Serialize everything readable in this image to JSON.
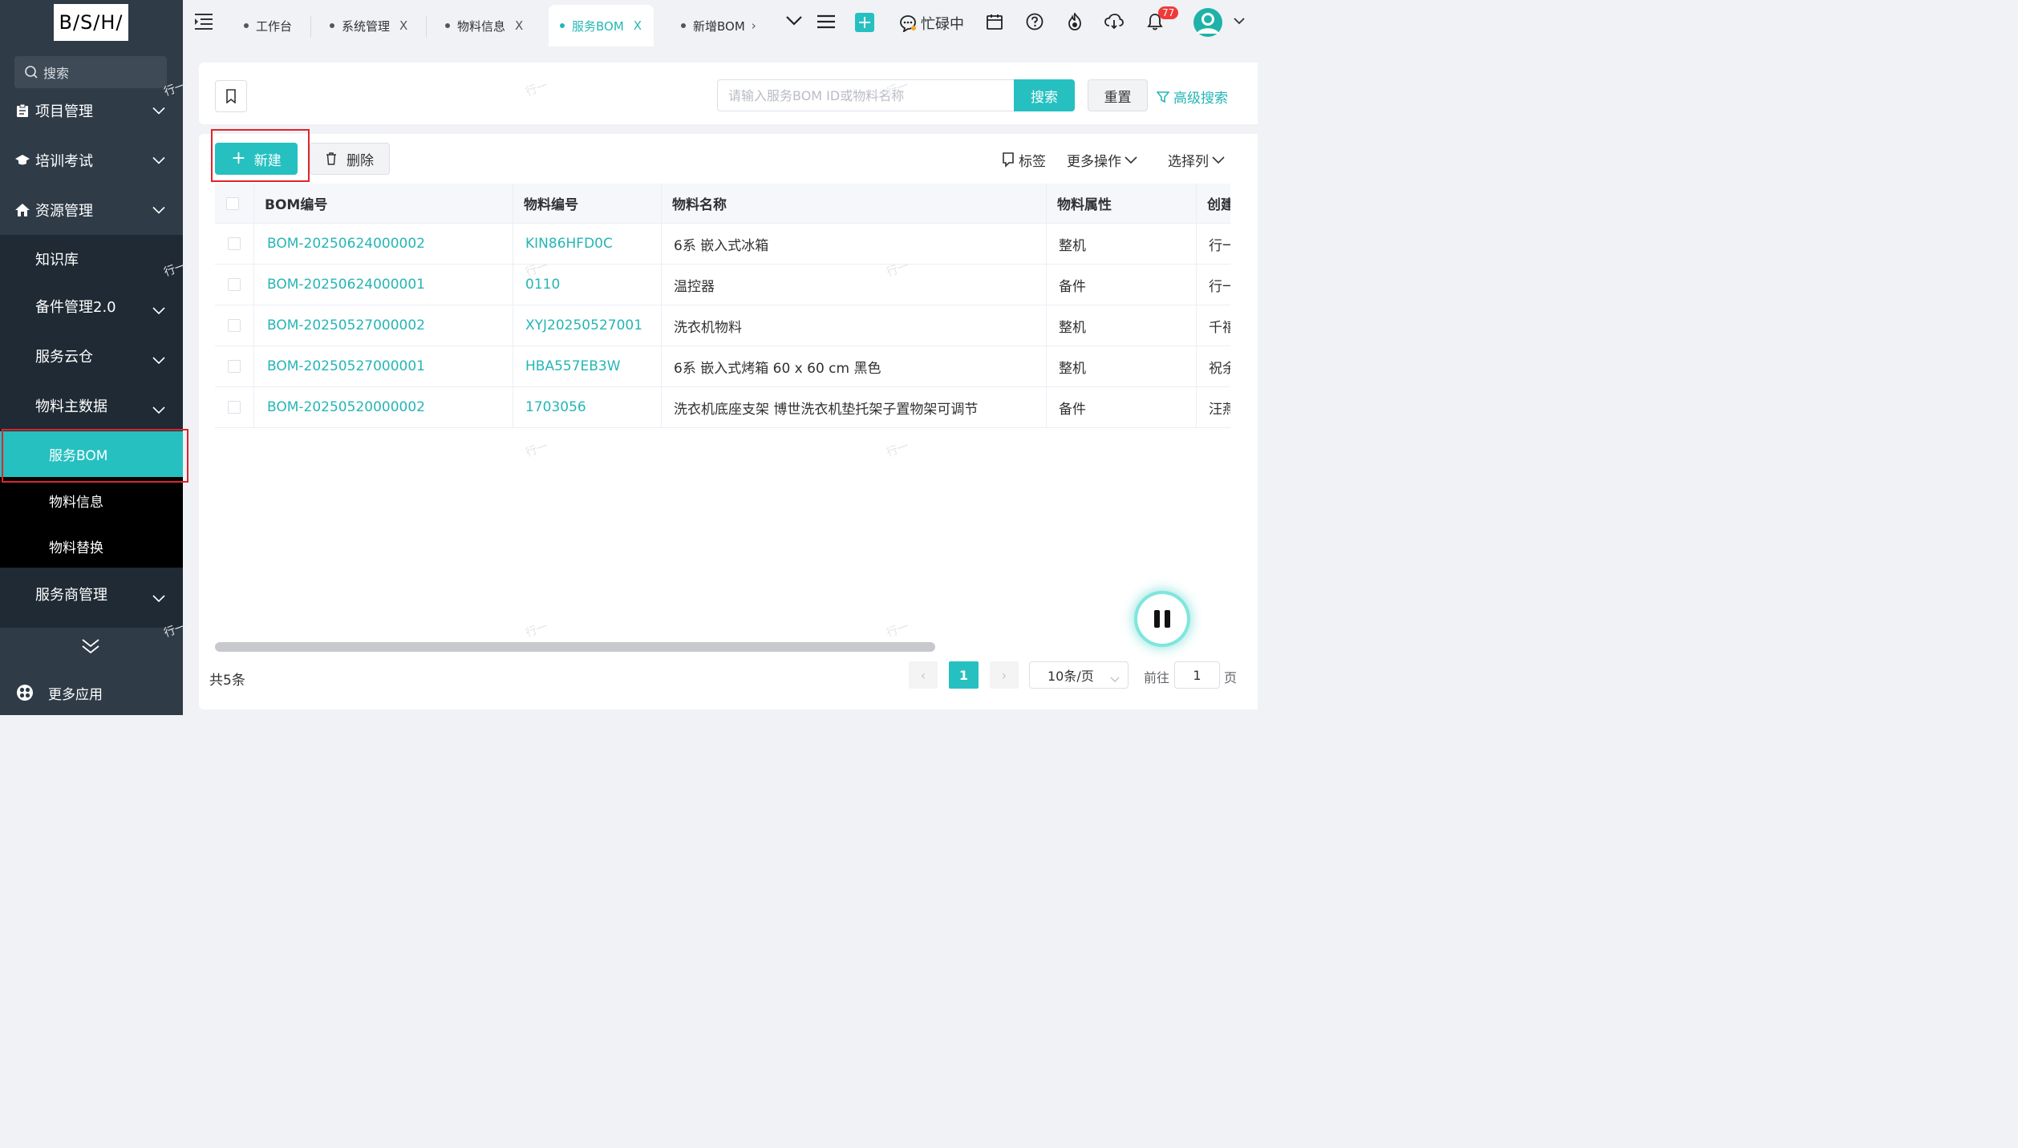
{
  "logo": "B/S/H/",
  "sidebar": {
    "search_label": "搜索",
    "menus": [
      {
        "label": "项目管理"
      },
      {
        "label": "培训考试"
      },
      {
        "label": "资源管理"
      }
    ],
    "resource_sub": [
      {
        "label": "知识库"
      },
      {
        "label": "备件管理2.0"
      },
      {
        "label": "服务云仓"
      },
      {
        "label": "物料主数据"
      }
    ],
    "material_sub": [
      {
        "label": "服务BOM",
        "active": true
      },
      {
        "label": "物料信息"
      },
      {
        "label": "物料替换"
      }
    ],
    "provider_menu": "服务商管理",
    "more_apps": "更多应用"
  },
  "tabs": [
    {
      "label": "工作台"
    },
    {
      "label": "系统管理",
      "close": "X"
    },
    {
      "label": "物料信息",
      "close": "X"
    },
    {
      "label": "服务BOM",
      "close": "X",
      "active": true
    },
    {
      "label": "新增BOM",
      "close": "›"
    }
  ],
  "topbar": {
    "status": "忙碌中",
    "notification_count": "77"
  },
  "search": {
    "placeholder": "请输入服务BOM ID或物料名称",
    "value": "",
    "search_btn": "搜索",
    "reset_btn": "重置",
    "advanced": "高级搜索"
  },
  "toolbar": {
    "new_btn": "新建",
    "delete_btn": "删除",
    "tag": "标签",
    "more_ops": "更多操作",
    "select_cols": "选择列"
  },
  "table": {
    "headers": [
      "BOM编号",
      "物料编号",
      "物料名称",
      "物料属性",
      "创建"
    ],
    "rows": [
      [
        "BOM-20250624000002",
        "KIN86HFD0C",
        "6系 嵌入式冰箱",
        "整机",
        "行一"
      ],
      [
        "BOM-20250624000001",
        "0110",
        "温控器",
        "备件",
        "行一"
      ],
      [
        "BOM-20250527000002",
        "XYJ20250527001",
        "洗衣机物料",
        "整机",
        "千禧"
      ],
      [
        "BOM-20250527000001",
        "HBA557EB3W",
        "6系 嵌入式烤箱 60 x 60 cm 黑色",
        "整机",
        "祝余"
      ],
      [
        "BOM-20250520000002",
        "1703056",
        "洗衣机底座支架 博世洗衣机垫托架子置物架可调节",
        "备件",
        "汪燕"
      ]
    ]
  },
  "pagination": {
    "total": "共5条",
    "prev": "‹",
    "current": "1",
    "next": "›",
    "page_size": "10条/页",
    "goto_label": "前往",
    "goto_value": "1",
    "page_unit": "页"
  },
  "watermark": "行一"
}
